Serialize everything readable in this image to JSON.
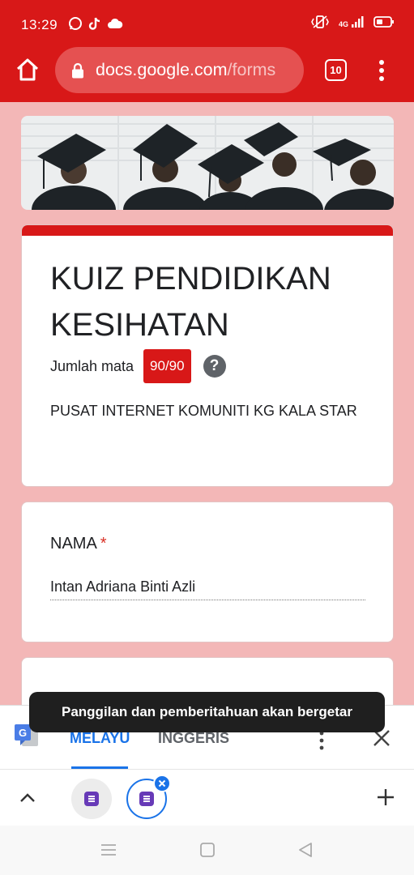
{
  "status_bar": {
    "time": "13:29",
    "network_label": "4G",
    "icons_left": [
      "whatsapp-icon",
      "tiktok-icon",
      "cloud-icon"
    ],
    "icons_right": [
      "vibrate-icon",
      "signal-icon",
      "battery-icon"
    ]
  },
  "browser": {
    "url_host": "docs.google.com",
    "url_path": "/forms",
    "tab_count": "10",
    "theme_color": "#d81818"
  },
  "form": {
    "title": "KUIZ PENDIDIKAN KESIHATAN",
    "score_label": "Jumlah mata",
    "score_value": "90/90",
    "description": "PUSAT INTERNET KOMUNITI KG KALA STAR",
    "questions": [
      {
        "label": "NAMA",
        "required": "*",
        "answer": "Intan Adriana Binti Azli"
      }
    ]
  },
  "translate_bar": {
    "languages": [
      "MELAYU",
      "INGGERIS"
    ],
    "active_language": "MELAYU"
  },
  "toast": {
    "message": "Panggilan dan pemberitahuan akan bergetar"
  },
  "bubbles": {
    "count": 2,
    "app_icon": "google-forms-icon"
  },
  "nav_bar": {
    "buttons": [
      "menu-icon",
      "home-icon",
      "back-icon"
    ]
  }
}
